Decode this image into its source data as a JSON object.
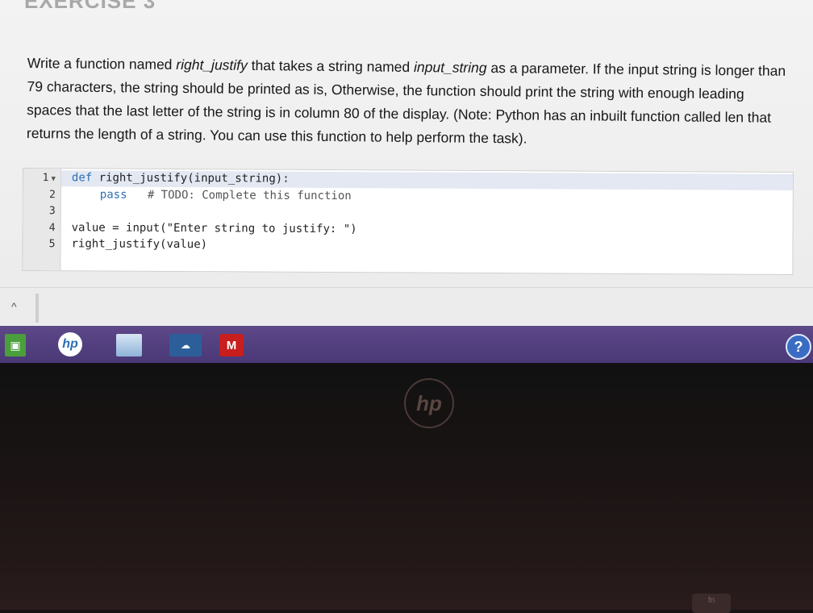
{
  "heading_partial": "EXERCISE 3",
  "prompt": {
    "p1": "Write a function named ",
    "fn_name": "right_justify",
    "p2": " that takes a string named ",
    "param_name": "input_string",
    "p3": " as a parameter. If the input string is longer than 79 characters, the string should be printed as is, Otherwise, the function should print the string with enough leading spaces that the last letter of the string is in column 80 of the display. (Note: Python has an inbuilt function called len that returns the length of a string. You can use this function to help perform the task)."
  },
  "editor": {
    "line_numbers": [
      "1",
      "2",
      "3",
      "4",
      "5"
    ],
    "line1_kw": "def",
    "line1_rest": " right_justify(input_string):",
    "line2_kw": "pass",
    "line2_comment": "# TODO: Complete this function",
    "line4": "value = input(\"Enter string to justify: \")",
    "line5": "right_justify(value)"
  },
  "taskbar": {
    "icons": [
      "windows-store-icon",
      "hp-icon",
      "file-explorer-icon",
      "cloud-icon",
      "mcafee-icon",
      "help-icon"
    ],
    "hp_label": "hp",
    "mcafee_label": "M",
    "help_label": "?"
  },
  "bezel": {
    "logo": "hp",
    "key_label": "fn"
  }
}
